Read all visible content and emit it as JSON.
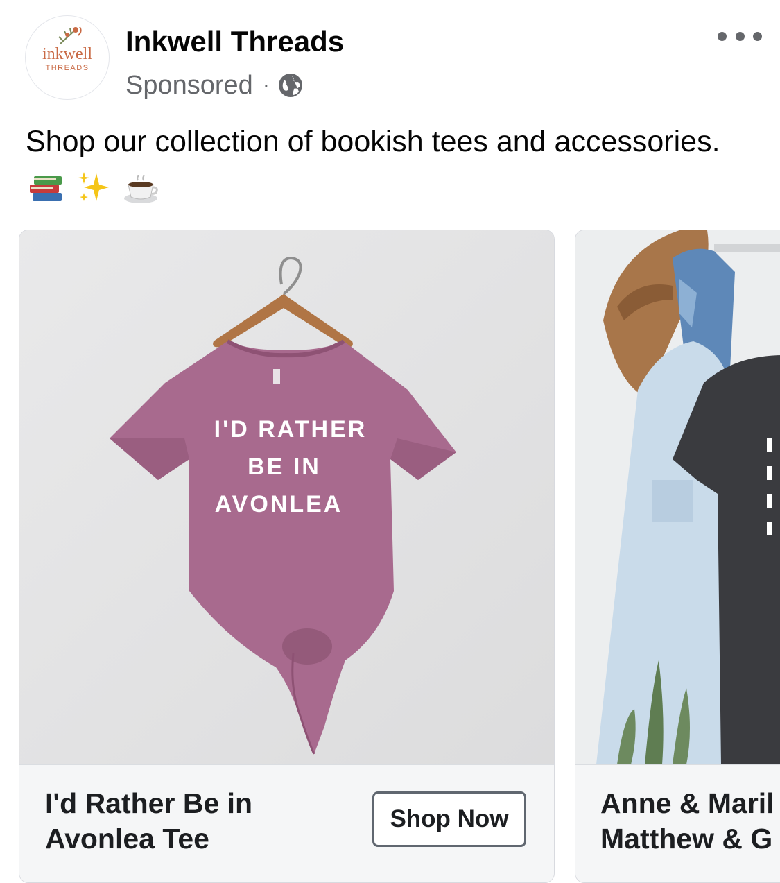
{
  "post": {
    "page_name": "Inkwell Threads",
    "sponsored_label": "Sponsored",
    "separator": "·",
    "caption_text": "Shop our collection of bookish tees and accessories.",
    "caption_emojis": [
      "books-emoji",
      "sparkles-emoji",
      "coffee-emoji"
    ]
  },
  "logo": {
    "wordmark": "inkwell",
    "subtitle": "THREADS",
    "color": "#c96a45"
  },
  "carousel": [
    {
      "title_line1": "I'd Rather Be in",
      "title_line2": "Avonlea Tee",
      "cta_label": "Shop Now",
      "shirt_print": [
        "I'D RATHER",
        "BE IN",
        "AVONLEA"
      ],
      "shirt_color": "#a86a8e"
    },
    {
      "title_line1": "Anne & Maril",
      "title_line2": "Matthew & G"
    }
  ],
  "colors": {
    "text_primary": "#050505",
    "text_secondary": "#65676b",
    "card_footer_bg": "#f5f6f7",
    "card_border": "#d8dadf"
  }
}
